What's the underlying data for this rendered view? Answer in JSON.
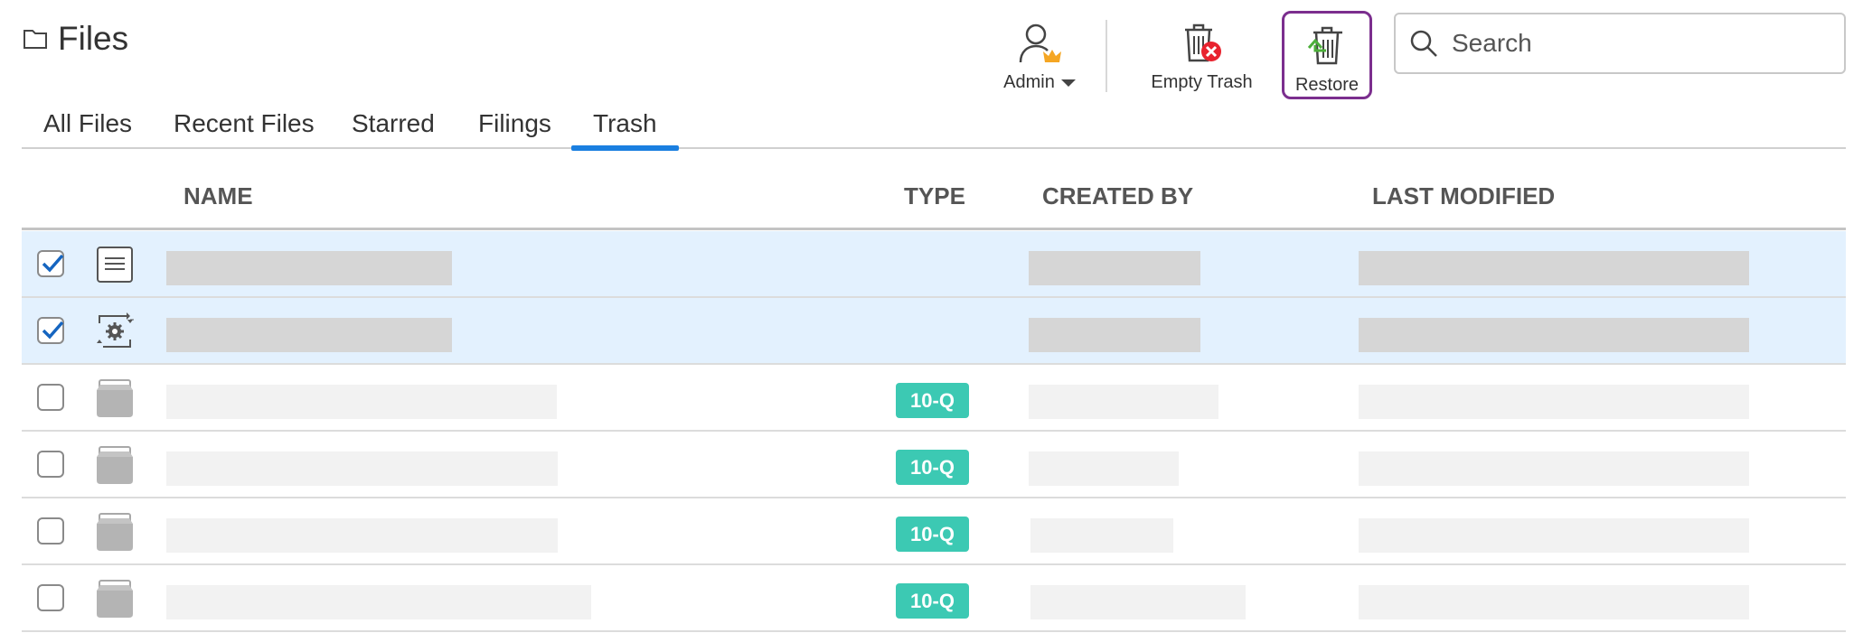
{
  "header": {
    "title": "Files",
    "admin_label": "Admin",
    "empty_trash_label": "Empty Trash",
    "restore_label": "Restore",
    "search_placeholder": "Search"
  },
  "tabs": [
    {
      "label": "All Files",
      "active": false
    },
    {
      "label": "Recent Files",
      "active": false
    },
    {
      "label": "Starred",
      "active": false
    },
    {
      "label": "Filings",
      "active": false
    },
    {
      "label": "Trash",
      "active": true
    }
  ],
  "table": {
    "columns": [
      "NAME",
      "TYPE",
      "CREATED BY",
      "LAST MODIFIED"
    ],
    "rows": [
      {
        "checked": true,
        "icon": "document-icon",
        "type": ""
      },
      {
        "checked": true,
        "icon": "sync-settings-icon",
        "type": ""
      },
      {
        "checked": false,
        "icon": "filing-box-icon",
        "type": "10-Q"
      },
      {
        "checked": false,
        "icon": "filing-box-icon",
        "type": "10-Q"
      },
      {
        "checked": false,
        "icon": "filing-box-icon",
        "type": "10-Q"
      },
      {
        "checked": false,
        "icon": "filing-box-icon",
        "type": "10-Q"
      }
    ]
  },
  "colors": {
    "accent": "#1a7fe0",
    "selected_row": "#e3f1fe",
    "badge": "#3cc9b3",
    "restore_border": "#7b2e8e",
    "delete_red": "#e8222e",
    "restore_green": "#4caf3a",
    "crown": "#f5a623"
  }
}
